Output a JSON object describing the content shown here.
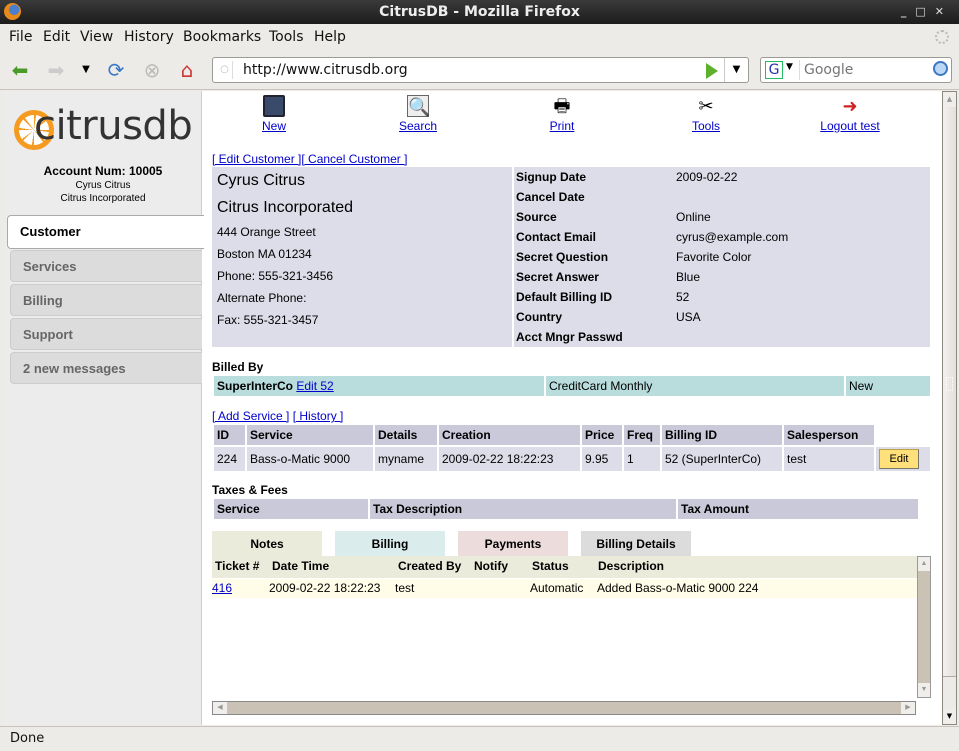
{
  "window": {
    "title": "CitrusDB - Mozilla Firefox"
  },
  "menu": [
    "File",
    "Edit",
    "View",
    "History",
    "Bookmarks",
    "Tools",
    "Help"
  ],
  "nav": {
    "url": "http://www.citrusdb.org",
    "search_placeholder": "Google"
  },
  "sidebar": {
    "logo_text": "citrusdb",
    "account_label": "Account Num:  10005",
    "account_name": "Cyrus Citrus",
    "account_company": "Citrus Incorporated",
    "tabs": [
      {
        "label": "Customer",
        "active": true
      },
      {
        "label": "Services"
      },
      {
        "label": "Billing"
      },
      {
        "label": "Support"
      },
      {
        "label": "2 new messages"
      }
    ]
  },
  "toolbar": {
    "items": [
      {
        "label": "New",
        "icon": "floppy-disk-icon"
      },
      {
        "label": "Search",
        "icon": "magnifier-icon"
      },
      {
        "label": "Print",
        "icon": "printer-icon"
      },
      {
        "label": "Tools",
        "icon": "tools-icon"
      },
      {
        "label": "Logout test",
        "icon": "logout-door-icon"
      }
    ]
  },
  "customer": {
    "edit_link": "[ Edit Customer ]",
    "cancel_link": "[ Cancel Customer ]",
    "name": "Cyrus Citrus",
    "company": "Citrus Incorporated",
    "street": "444 Orange Street",
    "city_state_zip": "Boston MA 01234",
    "phone": "Phone: 555-321-3456",
    "alt_phone": "Alternate Phone:",
    "fax": "Fax: 555-321-3457",
    "fields": [
      {
        "label": "Signup Date",
        "value": "2009-02-22"
      },
      {
        "label": "Cancel Date",
        "value": ""
      },
      {
        "label": "Source",
        "value": "Online"
      },
      {
        "label": "Contact Email",
        "value": "cyrus@example.com"
      },
      {
        "label": "Secret Question",
        "value": "Favorite Color"
      },
      {
        "label": "Secret Answer",
        "value": "Blue"
      },
      {
        "label": "Default Billing ID",
        "value": "52"
      },
      {
        "label": "Country",
        "value": "USA"
      },
      {
        "label": "Acct Mngr Passwd",
        "value": ""
      }
    ]
  },
  "billed_by": {
    "title": "Billed By",
    "org": "SuperInterCo",
    "edit_link": "Edit 52",
    "method": "CreditCard Monthly",
    "status": "New"
  },
  "services": {
    "add_link": "[ Add Service ]",
    "history_link": "[ History ]",
    "columns": [
      "ID",
      "Service",
      "Details",
      "Creation",
      "Price",
      "Freq",
      "Billing ID",
      "Salesperson"
    ],
    "rows": [
      [
        "224",
        "Bass-o-Matic 9000",
        "myname",
        "2009-02-22 18:22:23",
        "9.95",
        "1",
        "52 (SuperInterCo)",
        "test"
      ]
    ],
    "edit_label": "Edit"
  },
  "taxes": {
    "title": "Taxes & Fees",
    "columns": [
      "Service",
      "Tax Description",
      "Tax Amount"
    ]
  },
  "history_tabs": [
    {
      "label": "Notes",
      "color": "#ebebdc"
    },
    {
      "label": "Billing",
      "color": "#dbecec"
    },
    {
      "label": "Payments",
      "color": "#ecdcdc"
    },
    {
      "label": "Billing Details",
      "color": "#dcdcdc"
    }
  ],
  "notes": {
    "columns": [
      "Ticket #",
      "Date Time",
      "Created By",
      "Notify",
      "Status",
      "Description"
    ],
    "rows": [
      [
        "416",
        "2009-02-22 18:22:23",
        "test",
        "",
        "Automatic",
        "Added Bass-o-Matic 9000 224"
      ]
    ]
  },
  "status": "Done"
}
